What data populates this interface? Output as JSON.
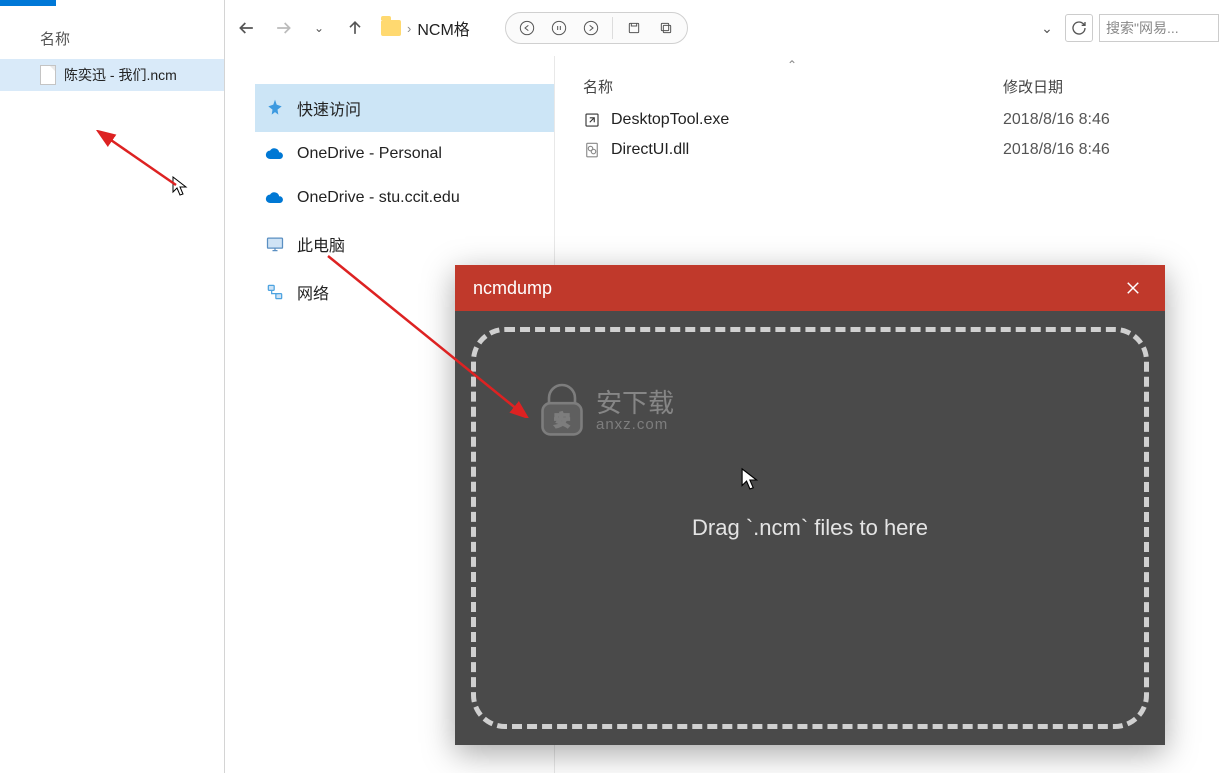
{
  "left": {
    "header": "名称",
    "file": "陈奕迅 - 我们.ncm"
  },
  "toolbar": {
    "breadcrumb_text": "NCM格",
    "search_placeholder": "搜索\"网易..."
  },
  "nav": {
    "quick": "快速访问",
    "onedrive1": "OneDrive - Personal",
    "onedrive2": "OneDrive - stu.ccit.edu",
    "pc": "此电脑",
    "network": "网络"
  },
  "cols": {
    "name": "名称",
    "date": "修改日期"
  },
  "files": [
    {
      "name": "DesktopTool.exe",
      "date": "2018/8/16 8:46"
    },
    {
      "name": "DirectUI.dll",
      "date": "2018/8/16 8:46"
    }
  ],
  "ncm": {
    "title": "ncmdump",
    "drop_text": "Drag `.ncm` files to here",
    "watermark_main": "安下载",
    "watermark_sub": "anxz.com"
  }
}
